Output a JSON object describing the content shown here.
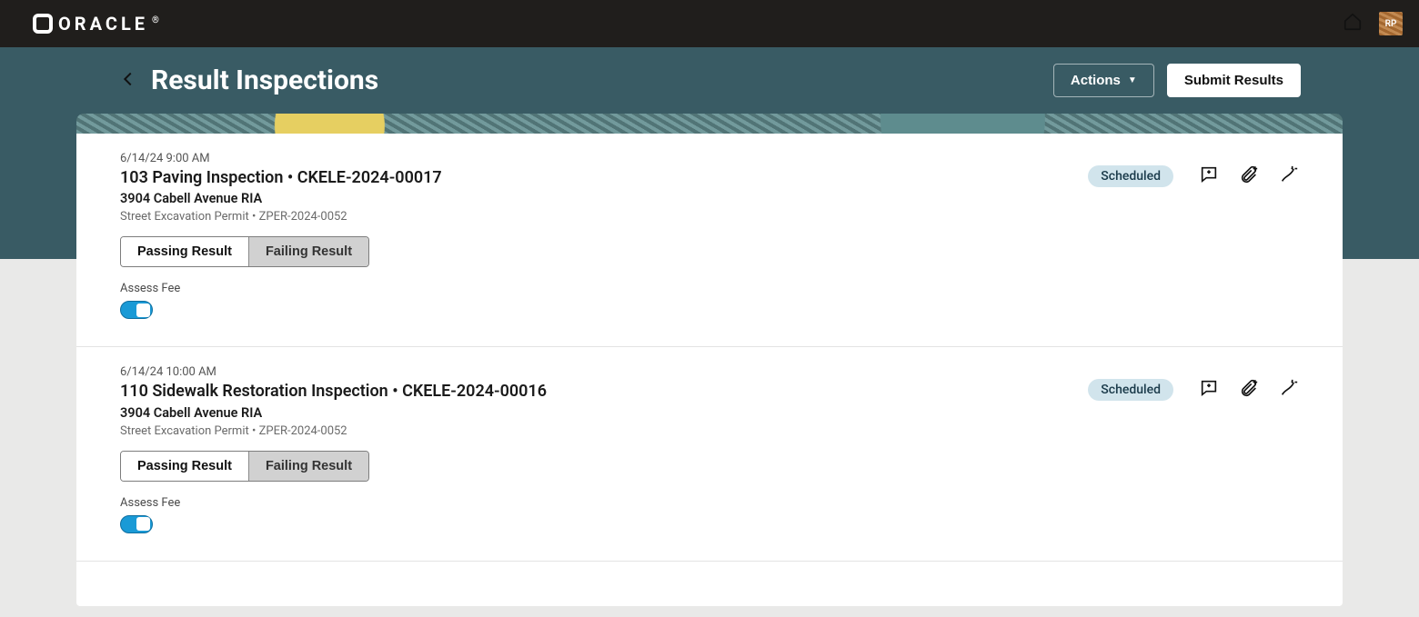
{
  "brand": {
    "name": "ORACLE",
    "reg": "®"
  },
  "user": {
    "initials": "RP"
  },
  "page": {
    "title": "Result Inspections",
    "actions_label": "Actions",
    "submit_label": "Submit Results"
  },
  "segment_labels": {
    "pass": "Passing Result",
    "fail": "Failing Result"
  },
  "assess_fee_label": "Assess Fee",
  "status_labels": {
    "scheduled": "Scheduled"
  },
  "inspections": [
    {
      "timestamp": "6/14/24 9:00 AM",
      "title": "103 Paving Inspection",
      "record": "CKELE-2024-00017",
      "title_sep": " • ",
      "address": "3904 Cabell Avenue RIA",
      "permit_type": "Street Excavation Permit",
      "permit_no": "ZPER-2024-0052",
      "permit_sep": " • ",
      "status": "Scheduled",
      "assess_fee_on": true
    },
    {
      "timestamp": "6/14/24 10:00 AM",
      "title": "110 Sidewalk Restoration Inspection",
      "record": "CKELE-2024-00016",
      "title_sep": " • ",
      "address": "3904 Cabell Avenue RIA",
      "permit_type": "Street Excavation Permit",
      "permit_no": "ZPER-2024-0052",
      "permit_sep": " • ",
      "status": "Scheduled",
      "assess_fee_on": true
    }
  ]
}
